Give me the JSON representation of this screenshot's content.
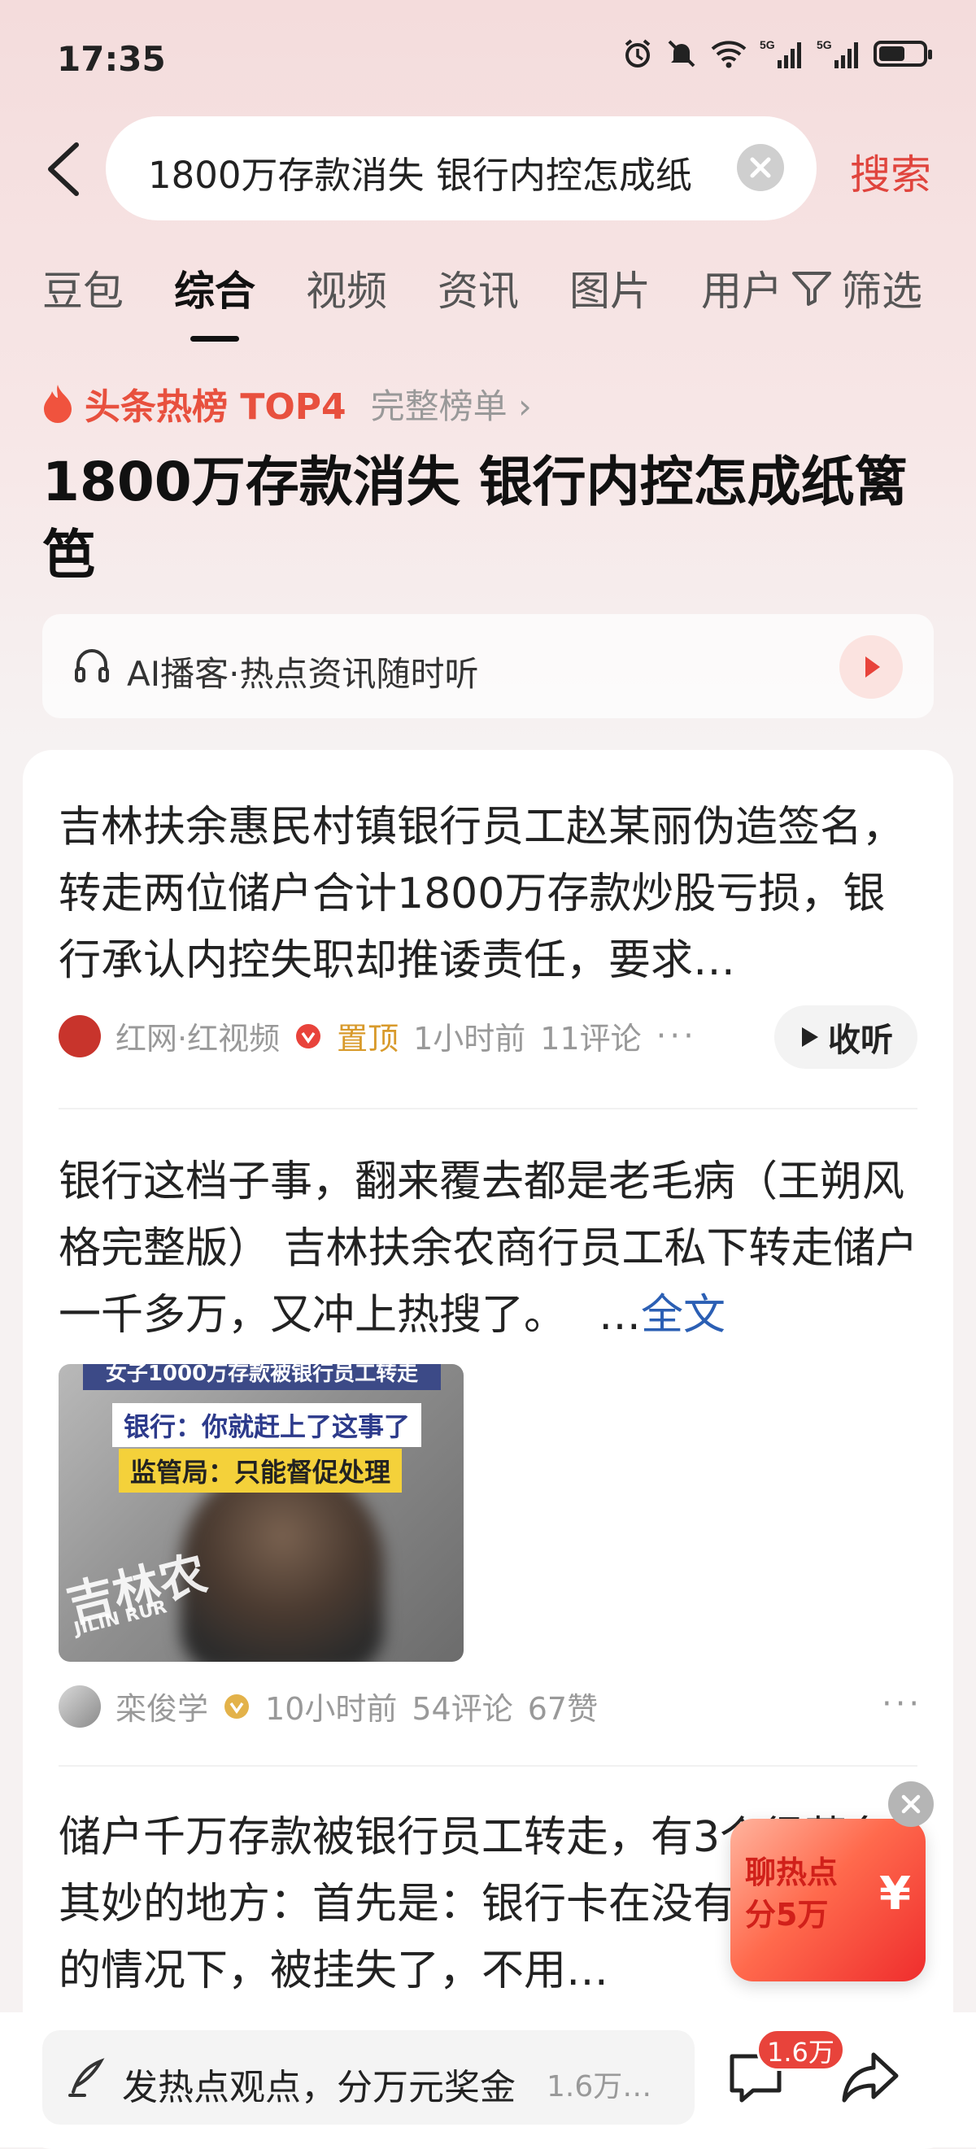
{
  "status_bar": {
    "time": "17:35",
    "icons": [
      "alarm-icon",
      "mute-icon",
      "wifi-icon",
      "signal-5g-icon",
      "signal-5g-icon",
      "battery-icon"
    ],
    "battery_level": 0.6
  },
  "search": {
    "query": "1800万存款消失 银行内控怎成纸",
    "button_label": "搜索"
  },
  "tabs": [
    {
      "label": "豆包",
      "active": false
    },
    {
      "label": "综合",
      "active": true
    },
    {
      "label": "视频",
      "active": false
    },
    {
      "label": "资讯",
      "active": false
    },
    {
      "label": "图片",
      "active": false
    },
    {
      "label": "用户",
      "active": false
    }
  ],
  "filter_label": "筛选",
  "hot_rank": {
    "label": "头条热榜 TOP4",
    "more_label": "完整榜单 ›",
    "headline": "1800万存款消失 银行内控怎成纸篱笆"
  },
  "ai_podcast": {
    "label": "AI播客·热点资讯随时听"
  },
  "feed": {
    "item1": {
      "text": "吉林扶余惠民村镇银行员工赵某丽伪造签名，转走两位储户合计1800万存款炒股亏损，银行承认内控失职却推诿责任，要求…",
      "source": "红网·红视频",
      "pinned": "置顶",
      "time": "1小时前",
      "comments": "11评论",
      "listen_label": "收听"
    },
    "item2": {
      "text": "银行这档子事，翻来覆去都是老毛病（王朔风格完整版） 吉林扶余农商行员工私下转走储户一千多万，又冲上热搜了。",
      "ellipsis": "…",
      "more_label": "全文",
      "thumb_title": "女子1000万存款被银行员工转走",
      "thumb_cap1": "银行：你就赶上了这事了",
      "thumb_cap2": "监管局：只能督促处理",
      "thumb_logo": "吉林农",
      "thumb_logo_sub": "JILIN RUR",
      "author": "栾俊学",
      "time": "10小时前",
      "comments": "54评论",
      "likes": "67赞"
    },
    "item3": {
      "text": "储户千万存款被银行员工转走，有3个很莫名其妙的地方：首先是：银行卡在没有主人同意的情况下，被挂失了，不用…"
    }
  },
  "promo": {
    "line1": "聊热点",
    "line2": "分5万",
    "symbol": "¥"
  },
  "bottom_bar": {
    "comment_placeholder": "发热点观点，分万元奖金",
    "comment_count": "1.6万…",
    "badge": "1.6万"
  }
}
